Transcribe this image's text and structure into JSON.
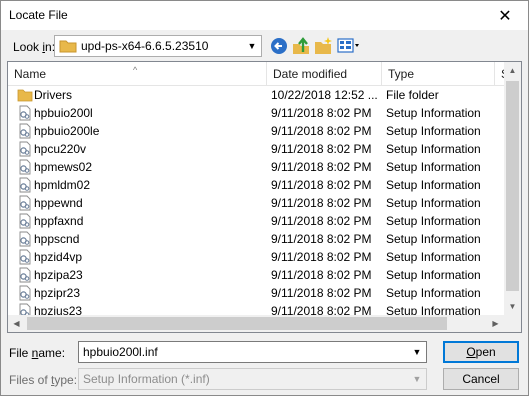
{
  "window": {
    "title": "Locate File",
    "close_glyph": "✕"
  },
  "toolbar": {
    "look_in_label_prefix": "Look ",
    "look_in_label_accel": "i",
    "look_in_label_suffix": "n:",
    "look_in_value": "upd-ps-x64-6.6.5.23510",
    "icons": [
      "back-icon",
      "up-folder-icon",
      "new-folder-icon",
      "view-menu-icon"
    ]
  },
  "columns": {
    "name": "Name",
    "date": "Date modified",
    "type": "Type",
    "size": "Si"
  },
  "files": [
    {
      "name": "Drivers",
      "date": "10/22/2018 12:52 ...",
      "type": "File folder",
      "icon": "folder-icon"
    },
    {
      "name": "hpbuio200l",
      "date": "9/11/2018 8:02 PM",
      "type": "Setup Information",
      "icon": "inf-file-icon"
    },
    {
      "name": "hpbuio200le",
      "date": "9/11/2018 8:02 PM",
      "type": "Setup Information",
      "icon": "inf-file-icon"
    },
    {
      "name": "hpcu220v",
      "date": "9/11/2018 8:02 PM",
      "type": "Setup Information",
      "icon": "inf-file-icon"
    },
    {
      "name": "hpmews02",
      "date": "9/11/2018 8:02 PM",
      "type": "Setup Information",
      "icon": "inf-file-icon"
    },
    {
      "name": "hpmldm02",
      "date": "9/11/2018 8:02 PM",
      "type": "Setup Information",
      "icon": "inf-file-icon"
    },
    {
      "name": "hppewnd",
      "date": "9/11/2018 8:02 PM",
      "type": "Setup Information",
      "icon": "inf-file-icon"
    },
    {
      "name": "hppfaxnd",
      "date": "9/11/2018 8:02 PM",
      "type": "Setup Information",
      "icon": "inf-file-icon"
    },
    {
      "name": "hppscnd",
      "date": "9/11/2018 8:02 PM",
      "type": "Setup Information",
      "icon": "inf-file-icon"
    },
    {
      "name": "hpzid4vp",
      "date": "9/11/2018 8:02 PM",
      "type": "Setup Information",
      "icon": "inf-file-icon"
    },
    {
      "name": "hpzipa23",
      "date": "9/11/2018 8:02 PM",
      "type": "Setup Information",
      "icon": "inf-file-icon"
    },
    {
      "name": "hpzipr23",
      "date": "9/11/2018 8:02 PM",
      "type": "Setup Information",
      "icon": "inf-file-icon"
    },
    {
      "name": "hpzius23",
      "date": "9/11/2018 8:02 PM",
      "type": "Setup Information",
      "icon": "inf-file-icon"
    }
  ],
  "filename": {
    "label_prefix": "File ",
    "label_accel": "n",
    "label_suffix": "ame:",
    "value": "hpbuio200l.inf"
  },
  "filetype": {
    "label_prefix": "Files of ",
    "label_accel": "t",
    "label_suffix": "ype:",
    "value": "Setup Information (*.inf)"
  },
  "buttons": {
    "open_accel": "O",
    "open_rest": "pen",
    "cancel": "Cancel"
  },
  "colors": {
    "accent": "#0078d7",
    "folder": "#e8b84a"
  }
}
